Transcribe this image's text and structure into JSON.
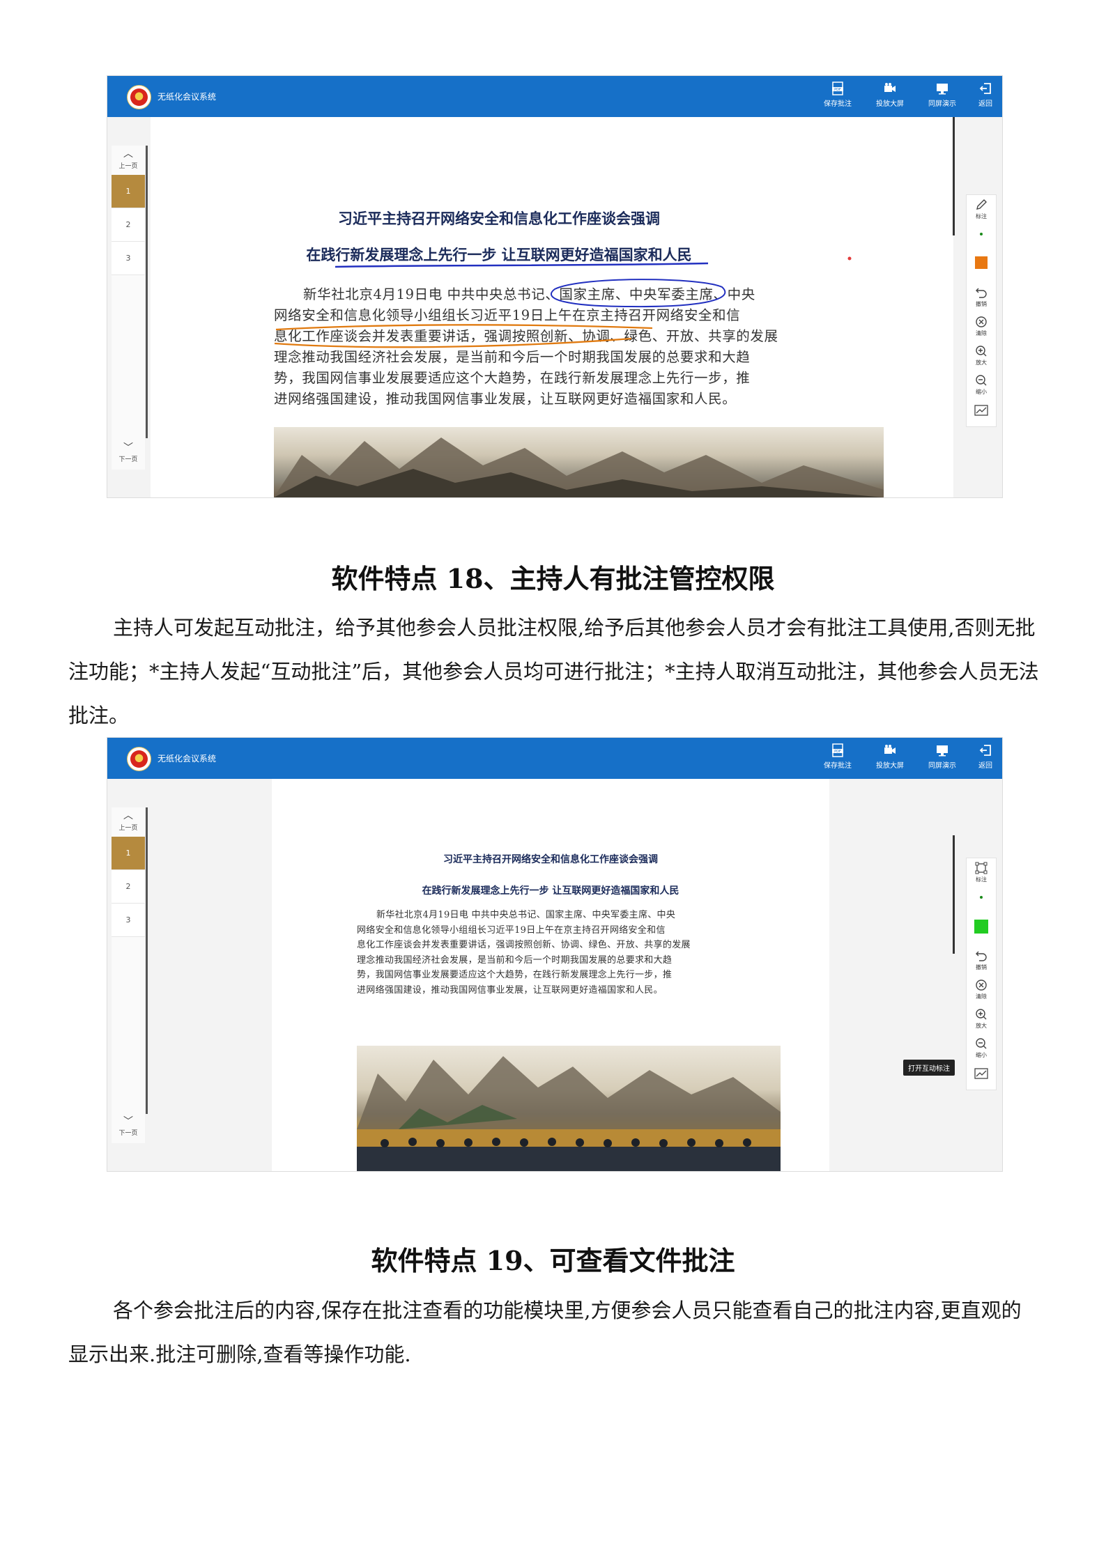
{
  "app": {
    "title": "无纸化会议系统",
    "toolbar": [
      {
        "label": "保存批注",
        "icon": "pdf-icon"
      },
      {
        "label": "投放大屏",
        "icon": "camera-icon"
      },
      {
        "label": "同屏演示",
        "icon": "monitor-icon"
      },
      {
        "label": "返回",
        "icon": "exit-icon"
      }
    ],
    "pager": {
      "prev_label": "上一页",
      "next_label": "下一页",
      "pages": [
        "1",
        "2",
        "3"
      ],
      "active_page": "1"
    },
    "tools": {
      "annotate_label": "标注",
      "undo_label": "撤销",
      "clear_label": "清除",
      "zoom_in_label": "放大",
      "zoom_out_label": "缩小"
    }
  },
  "document": {
    "title": "习近平主持召开网络安全和信息化工作座谈会强调",
    "subtitle": "在践行新发展理念上先行一步 让互联网更好造福国家和人民",
    "lines": [
      "新华社北京4月19日电 中共中央总书记、国家主席、中央军委主席、中央",
      "网络安全和信息化领导小组组长习近平19日上午在京主持召开网络安全和信",
      "息化工作座谈会并发表重要讲话，强调按照创新、协调、绿色、开放、共享的发展",
      "理念推动我国经济社会发展，是当前和今后一个时期我国发展的总要求和大趋",
      "势，我国网信事业发展要适应这个大趋势，在践行新发展理念上先行一步，推",
      "进网络强国建设，推动我国网信事业发展，让互联网更好造福国家和人民。"
    ]
  },
  "screenshot1": {
    "pen_color": "#e87812"
  },
  "screenshot2": {
    "pen_color": "#22cc22",
    "tooltip": "打开互动标注"
  },
  "section18": {
    "heading": "软件特点 18、主持人有批注管控权限",
    "text": "主持人可发起互动批注，给予其他参会人员批注权限,给予后其他参会人员才会有批注工具使用,否则无批注功能；*主持人发起“互动批注”后，其他参会人员均可进行批注；*主持人取消互动批注，其他参会人员无法批注。"
  },
  "section19": {
    "heading": "软件特点 19、可查看文件批注",
    "text": "各个参会批注后的内容,保存在批注查看的功能模块里,方便参会人员只能查看自己的批注内容,更直观的显示出来.批注可删除,查看等操作功能."
  },
  "colors": {
    "topbar": "#1670c8",
    "active_page": "#b58a3e",
    "ink_blue": "#2230c0",
    "ink_orange": "#e07a10"
  }
}
